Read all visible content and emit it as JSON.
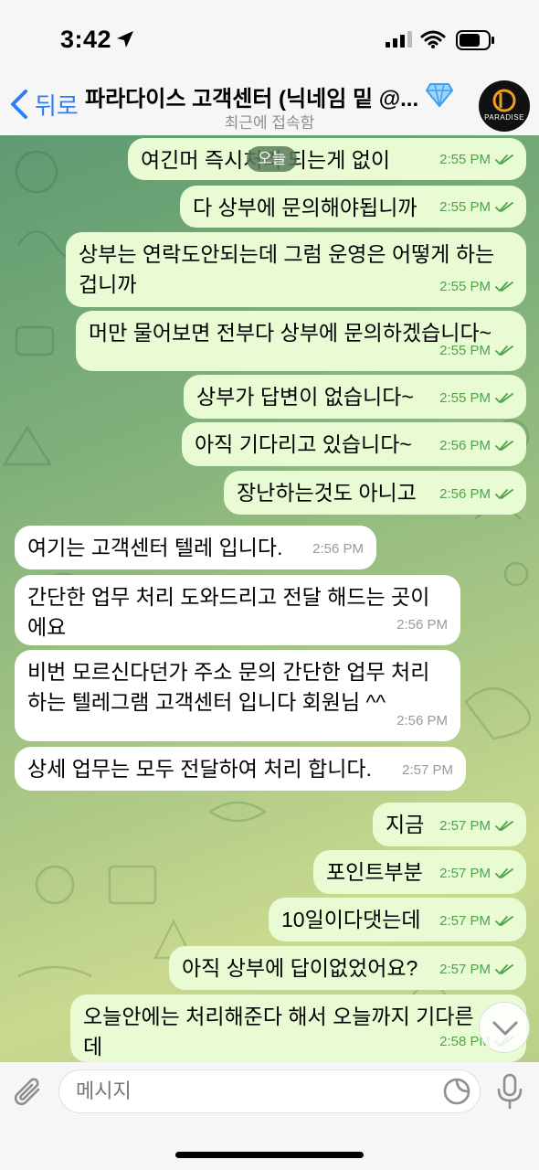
{
  "status_bar": {
    "time": "3:42"
  },
  "header": {
    "back_label": "뒤로",
    "title": "파라다이스 고객센터 (닉네임 밑 @...",
    "subtitle": "최근에 접속함",
    "avatar_text": "PARADISE"
  },
  "date_badge": "오늘",
  "messages": [
    {
      "dir": "out",
      "text": "여긴머 즉시처리 되는게 없이",
      "time": "2:55 PM"
    },
    {
      "dir": "out",
      "text": "다 상부에 문의해야됩니까",
      "time": "2:55 PM"
    },
    {
      "dir": "out",
      "text": "상부는 연락도안되는데 그럼 운영은 어떻게 하는\n겁니까",
      "time": "2:55 PM"
    },
    {
      "dir": "out",
      "text": "머만 물어보면 전부다 상부에 문의하겠습니다~",
      "time": "2:55 PM"
    },
    {
      "dir": "out",
      "text": "상부가 답변이 없습니다~",
      "time": "2:55 PM"
    },
    {
      "dir": "out",
      "text": "아직 기다리고 있습니다~",
      "time": "2:56 PM"
    },
    {
      "dir": "out",
      "text": "장난하는것도 아니고",
      "time": "2:56 PM"
    },
    {
      "dir": "in",
      "text": "여기는 고객센터 텔레 입니다.",
      "time": "2:56 PM"
    },
    {
      "dir": "in",
      "text": "간단한 업무 처리 도와드리고 전달 해드는 곳이\n에요",
      "time": "2:56 PM"
    },
    {
      "dir": "in",
      "text": "비번 모르신다던가 주소 문의 간단한 업무 처리\n하는 텔레그램 고객센터 입니다 회원님 ^^",
      "time": "2:56 PM"
    },
    {
      "dir": "in",
      "text": "상세 업무는 모두 전달하여 처리 합니다.",
      "time": "2:57 PM"
    },
    {
      "dir": "out",
      "text": "지금",
      "time": "2:57 PM"
    },
    {
      "dir": "out",
      "text": "포인트부분",
      "time": "2:57 PM"
    },
    {
      "dir": "out",
      "text": "10일이다댓는데",
      "time": "2:57 PM"
    },
    {
      "dir": "out",
      "text": "아직 상부에 답이없었어요?",
      "time": "2:57 PM"
    },
    {
      "dir": "out",
      "text": "오늘안에는 처리해준다 해서 오늘까지 기다른\n데",
      "time": "2:58 PM"
    }
  ],
  "input": {
    "placeholder": "메시지"
  },
  "colors": {
    "accent": "#2f7ef6",
    "out_bubble": "#e8fbd3",
    "in_bubble": "#ffffff",
    "check": "#4fa34c"
  }
}
